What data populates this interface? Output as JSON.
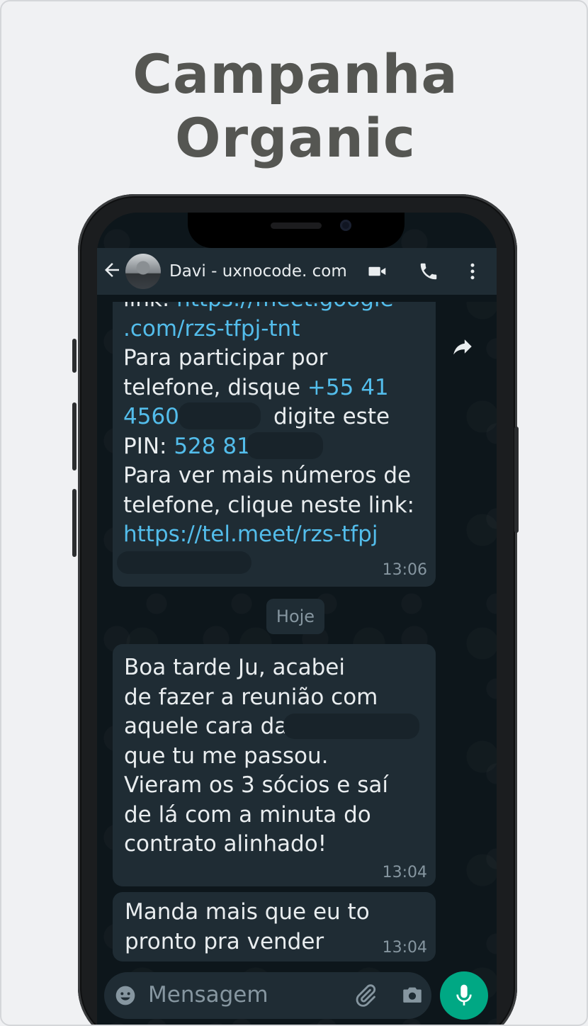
{
  "headline": {
    "line1": "Campanha",
    "line2": "Organic"
  },
  "header": {
    "back_icon": "arrow-left-icon",
    "contact_name": "Davi - uxnocode. com",
    "video_icon": "video-camera-icon",
    "call_icon": "phone-icon",
    "menu_icon": "kebab-menu-icon"
  },
  "messages": {
    "first": {
      "lines": [
        {
          "text": "link: ",
          "link": "https://meet.google"
        },
        {
          "text": "",
          "link": ".com/rzs-tfpj-tnt"
        },
        {
          "text": "Para participar por",
          "link": ""
        },
        {
          "text": "telefone, disque ",
          "link": "+55 41"
        },
        {
          "text": "",
          "link": "4560-",
          "after": " digite este"
        },
        {
          "text": "PIN: ",
          "link": "528 81"
        },
        {
          "text": "Para ver mais números de",
          "link": ""
        },
        {
          "text": "telefone, clique neste link:",
          "link": ""
        },
        {
          "text": "",
          "link": "https://tel.meet/rzs-tfpj"
        }
      ],
      "time": "13:06"
    },
    "date_chip": "Hoje",
    "second": {
      "lines": [
        "Boa tarde Ju, acabei",
        "de fazer a reunião com",
        "aquele cara da",
        "que tu me passou.",
        "Vieram os 3 sócios e saí",
        "de lá com a minuta do",
        "contrato alinhado!"
      ],
      "time": "13:04"
    },
    "third": {
      "lines": [
        "Manda mais que eu to",
        "pronto pra vender"
      ],
      "time": "13:04"
    }
  },
  "input": {
    "placeholder": "Mensagem",
    "emoji_icon": "emoji-icon",
    "attach_icon": "paperclip-icon",
    "camera_icon": "camera-icon",
    "mic_icon": "microphone-icon"
  },
  "colors": {
    "background": "#f0f1f3",
    "headline": "#555652",
    "bubble": "#1f2c34",
    "link": "#53bdeb",
    "accent": "#00a884"
  }
}
